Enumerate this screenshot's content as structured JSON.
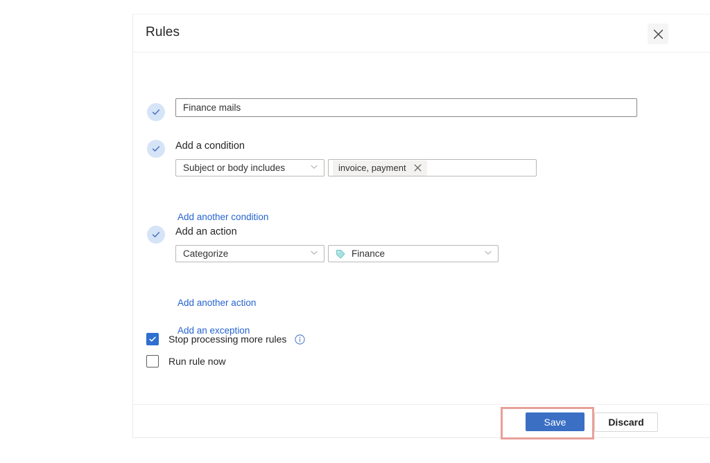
{
  "panel": {
    "title": "Rules",
    "close_icon": "close-icon"
  },
  "form": {
    "name_field": {
      "value": "Finance mails",
      "placeholder": "Name",
      "status_icon": "check-circle-icon"
    },
    "condition": {
      "heading": "Add a condition",
      "status_icon": "check-circle-icon",
      "type_select": {
        "value": "Subject or body includes",
        "chevron": "chevron-down-icon"
      },
      "value_field": {
        "chips": [
          "invoice, payment"
        ],
        "chip_remove_icon": "close-icon"
      },
      "add_link": "Add another condition"
    },
    "action": {
      "heading": "Add an action",
      "status_icon": "check-circle-icon",
      "type_select": {
        "value": "Categorize",
        "chevron": "chevron-down-icon"
      },
      "category_select": {
        "value": "Finance",
        "icon": "tag-icon",
        "icon_color": "#8ed6d6",
        "chevron": "chevron-down-icon"
      },
      "add_action_link": "Add another action",
      "add_exception_link": "Add an exception"
    },
    "options": [
      {
        "label": "Stop processing more rules",
        "checked": true,
        "info_icon": "info-icon"
      },
      {
        "label": "Run rule now",
        "checked": false
      }
    ]
  },
  "footer": {
    "save_label": "Save",
    "discard_label": "Discard"
  },
  "colors": {
    "accent": "#2564cf",
    "primary_button": "#3a6fc4",
    "checkbox_checked": "#2f6fd0",
    "step_circle": "#d6e4f7",
    "highlight": "#e8a09a",
    "tag": "#8ed6d6"
  }
}
